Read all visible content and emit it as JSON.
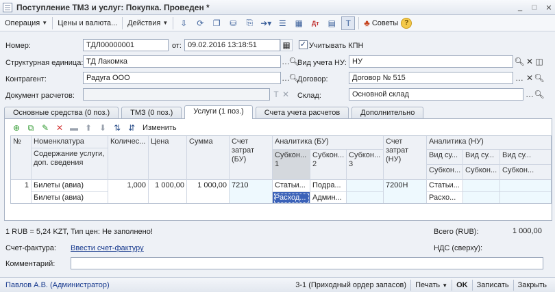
{
  "window": {
    "title": "Поступление ТМЗ и услуг: Покупка. Проведен *"
  },
  "toolbar": {
    "operation": "Операция",
    "prices": "Цены и валюта...",
    "actions": "Действия",
    "advice": "Советы"
  },
  "form": {
    "number_label": "Номер:",
    "number_value": "ТДЛ00000001",
    "date_label": "от:",
    "date_value": "09.02.2016 13:18:51",
    "kpn_label": "Учитывать КПН",
    "struct_label": "Структурная единица:",
    "struct_value": "ТД Лакомка",
    "nu_label": "Вид учета НУ:",
    "nu_value": "НУ",
    "contractor_label": "Контрагент:",
    "contractor_value": "Радуга ООО",
    "contract_label": "Договор:",
    "contract_value": "Договор № 515",
    "settlement_label": "Документ расчетов:",
    "settlement_value": "",
    "warehouse_label": "Склад:",
    "warehouse_value": "Основной склад"
  },
  "tabs": [
    {
      "label": "Основные средства (0 поз.)"
    },
    {
      "label": "ТМЗ (0 поз.)"
    },
    {
      "label": "Услуги (1 поз.)"
    },
    {
      "label": "Счета учета расчетов"
    },
    {
      "label": "Дополнительно"
    }
  ],
  "grid_toolbar": {
    "change_label": "Изменить"
  },
  "grid": {
    "headers": {
      "num": "№",
      "nomenclature": "Номенклатура",
      "content": "Содержание услуги, доп. сведения",
      "qty": "Количес...",
      "price": "Цена",
      "sum": "Сумма",
      "cost_account_bu": "Счет затрат (БУ)",
      "analytics_bu": "Аналитика (БУ)",
      "sub1": "Субкон... 1",
      "sub2": "Субкон... 2",
      "sub3": "Субкон... 3",
      "cost_account_nu": "Счет затрат (НУ)",
      "analytics_nu": "Аналитика (НУ)",
      "vid1": "Вид су...",
      "vid2": "Вид су...",
      "vid3": "Вид су...",
      "subk1": "Субкон...",
      "subk2": "Субкон...",
      "subk3": "Субкон..."
    },
    "row": {
      "num": "1",
      "nomenclature": "Билеты (авиа)",
      "content": "Билеты (авиа)",
      "qty": "1,000",
      "price": "1 000,00",
      "sum": "1 000,00",
      "cost_account_bu": "7210",
      "sub1_a": "Статьи...",
      "sub1_b": "Расход...",
      "sub2_a": "Подра...",
      "sub2_b": "Админ...",
      "cost_account_nu": "7200Н",
      "nu_a": "Статьи...",
      "nu_b": "Расхо..."
    }
  },
  "footer": {
    "rate": "1 RUB = 5,24 KZT, Тип цен: Не заполнено!",
    "total_label": "Всего (RUB):",
    "total_value": "1 000,00",
    "invoice_label": "Счет-фактура:",
    "invoice_link": "Ввести счет-фактуру",
    "vat_label": "НДС (сверху):",
    "comment_label": "Комментарий:",
    "comment_value": ""
  },
  "status": {
    "user": "Павлов А.В. (Администратор)",
    "receipt": "3-1 (Приходный ордер запасов)",
    "print": "Печать",
    "ok": "OK",
    "save": "Записать",
    "close": "Закрыть"
  }
}
